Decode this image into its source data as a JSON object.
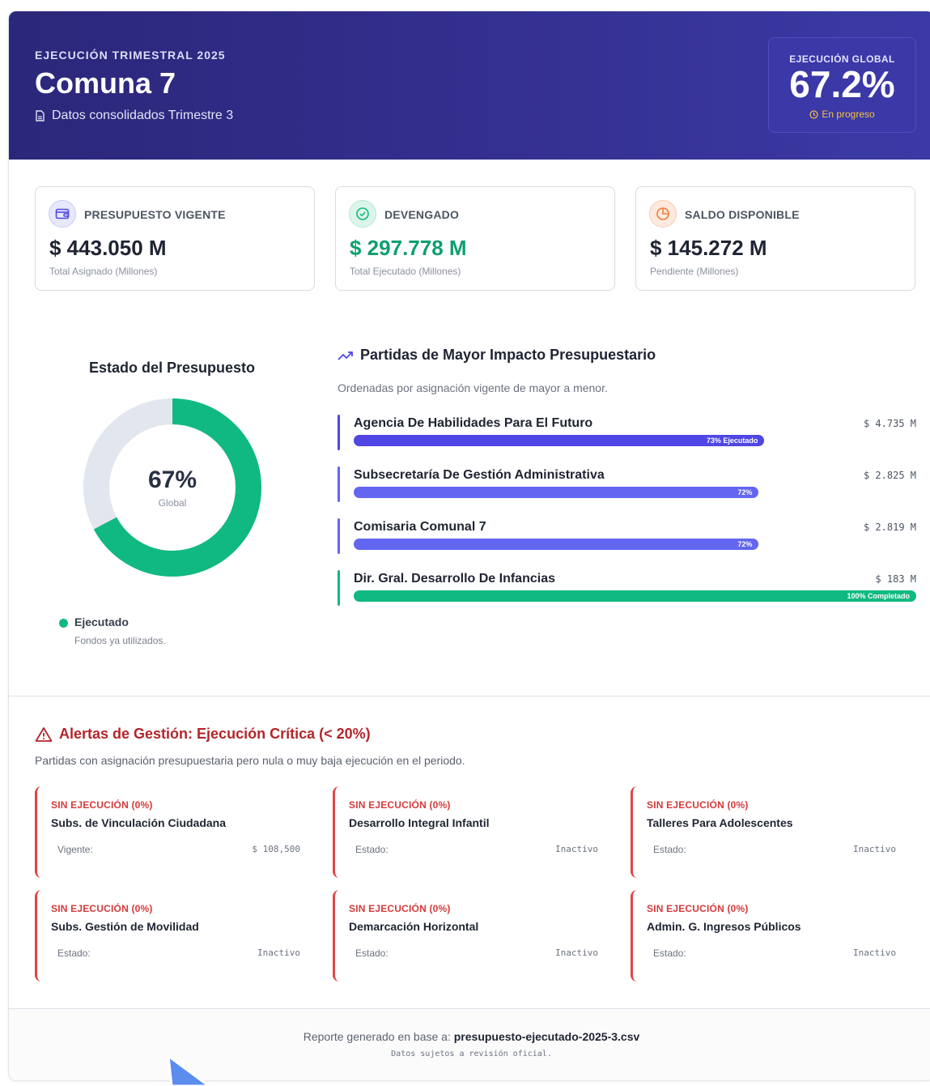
{
  "header": {
    "eyebrow": "EJECUCIÓN TRIMESTRAL 2025",
    "title": "Comuna 7",
    "subtitle": "Datos consolidados Trimestre 3",
    "global": {
      "label": "EJECUCIÓN GLOBAL",
      "value": "67.2%",
      "status": "En progreso"
    }
  },
  "kpis": [
    {
      "label": "PRESUPUESTO VIGENTE",
      "value": "$ 443.050 M",
      "note": "Total Asignado (Millones)",
      "icon": "wallet-icon",
      "color": "#1f2433"
    },
    {
      "label": "DEVENGADO",
      "value": "$ 297.778 M",
      "note": "Total Ejecutado (Millones)",
      "icon": "check-circle-icon",
      "color": "#0f9f6e"
    },
    {
      "label": "SALDO DISPONIBLE",
      "value": "$ 145.272 M",
      "note": "Pendiente (Millones)",
      "icon": "pie-chart-icon",
      "color": "#1f2433"
    }
  ],
  "donut": {
    "title": "Estado del Presupuesto",
    "center_value": "67%",
    "center_label": "Global",
    "executed_fraction": 0.672,
    "colors": {
      "executed": "#10b981",
      "remaining": "#e2e6ee"
    },
    "legend": {
      "name": "Ejecutado",
      "desc": "Fondos ya utilizados."
    }
  },
  "partidas": {
    "title": "Partidas de Mayor Impacto Presupuestario",
    "subtitle": "Ordenadas por asignación vigente de mayor a menor.",
    "items": [
      {
        "name": "Agencia De Habilidades Para El Futuro",
        "amount": "$ 4.735 M",
        "pct": 73,
        "label": "73% Ejecutado",
        "color": "#4f46e5"
      },
      {
        "name": "Subsecretaría De Gestión Administrativa",
        "amount": "$ 2.825 M",
        "pct": 72,
        "label": "72%",
        "color": "#6366f1"
      },
      {
        "name": "Comisaria Comunal 7",
        "amount": "$ 2.819 M",
        "pct": 72,
        "label": "72%",
        "color": "#6366f1"
      },
      {
        "name": "Dir. Gral. Desarrollo De Infancias",
        "amount": "$ 183 M",
        "pct": 100,
        "label": "100% Completado",
        "color": "#10b981"
      }
    ]
  },
  "alerts": {
    "title": "Alertas de Gestión: Ejecución Crítica (< 20%)",
    "subtitle": "Partidas con asignación presupuestaria pero nula o muy baja ejecución en el periodo.",
    "items": [
      {
        "tag": "SIN EJECUCIÓN (0%)",
        "name": "Subs. de Vinculación Ciudadana",
        "key": "Vigente:",
        "value": "$ 108,500"
      },
      {
        "tag": "SIN EJECUCIÓN (0%)",
        "name": "Desarrollo Integral Infantil",
        "key": "Estado:",
        "value": "Inactivo"
      },
      {
        "tag": "SIN EJECUCIÓN (0%)",
        "name": "Talleres Para Adolescentes",
        "key": "Estado:",
        "value": "Inactivo"
      },
      {
        "tag": "SIN EJECUCIÓN (0%)",
        "name": "Subs. Gestión de Movilidad",
        "key": "Estado:",
        "value": "Inactivo"
      },
      {
        "tag": "SIN EJECUCIÓN (0%)",
        "name": "Demarcación Horizontal",
        "key": "Estado:",
        "value": "Inactivo"
      },
      {
        "tag": "SIN EJECUCIÓN (0%)",
        "name": "Admin. G. Ingresos Públicos",
        "key": "Estado:",
        "value": "Inactivo"
      }
    ]
  },
  "footer": {
    "prefix": "Reporte generado en base a: ",
    "file": "presupuesto-ejecutado-2025-3.csv",
    "note": "Datos sujetos a revisión oficial."
  }
}
